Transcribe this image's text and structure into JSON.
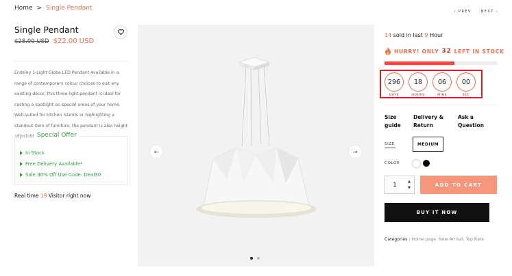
{
  "breadcrumb": {
    "home": "Home",
    "separator": ">",
    "current": "Single Pendant"
  },
  "pager": {
    "prev": "‹ PREV",
    "next": "NEXT ›"
  },
  "product": {
    "title": "Single Pendant",
    "old_price": "$28.00 USD",
    "new_price": "$22.00 USD",
    "description": "Endsley 1-Light Globe LED Pendant Available in a range of contemporary colour choices to suit any existing décor, this three-light pendant is ideal for casting a spotlight on special areas of your home. Well-suited for kitchen islands or highlighting a standout item of furniture, the pendant is also height adjustable..."
  },
  "offer": {
    "title": "Special Offer",
    "items": [
      "In Stock",
      "Free Delivery Available*",
      "Sale 30% Off Use Code: Deal30"
    ]
  },
  "visitors": {
    "prefix": "Real time",
    "count": "19",
    "suffix": "Visitor right now"
  },
  "sales": {
    "count": "14",
    "middle": "sold in last",
    "hours": "9",
    "suffix": "Hour"
  },
  "stock": {
    "prefix": "HURRY! ONLY",
    "count": "32",
    "suffix": "LEFT IN STOCK",
    "progress": 0.62
  },
  "countdown": [
    {
      "value": "296",
      "label": "DAYS"
    },
    {
      "value": "18",
      "label": "HOURS"
    },
    {
      "value": "06",
      "label": "MINS"
    },
    {
      "value": "00",
      "label": "SEC"
    }
  ],
  "links": {
    "size_guide": "Size guide",
    "delivery": "Delivery & Return",
    "ask": "Ask a Question"
  },
  "options": {
    "size_label": "SIZE",
    "size_value": "MEDIUM",
    "color_label": "COLOR"
  },
  "cart": {
    "quantity": "1",
    "add_label": "ADD TO CART",
    "buy_label": "BUY IT NOW"
  },
  "categories": {
    "label": "Categories :",
    "values": "Home page, New Arrival, Top Rate"
  },
  "colors": {
    "accent": "#ef6b4a",
    "offer_green": "#2e9e3e",
    "add_to_cart": "#f6977c",
    "highlight_box": "#e01f1f"
  },
  "icons": {
    "wishlist": "heart-icon",
    "stock": "fire-icon",
    "prev": "chevron-left-icon",
    "next": "chevron-right-icon"
  }
}
